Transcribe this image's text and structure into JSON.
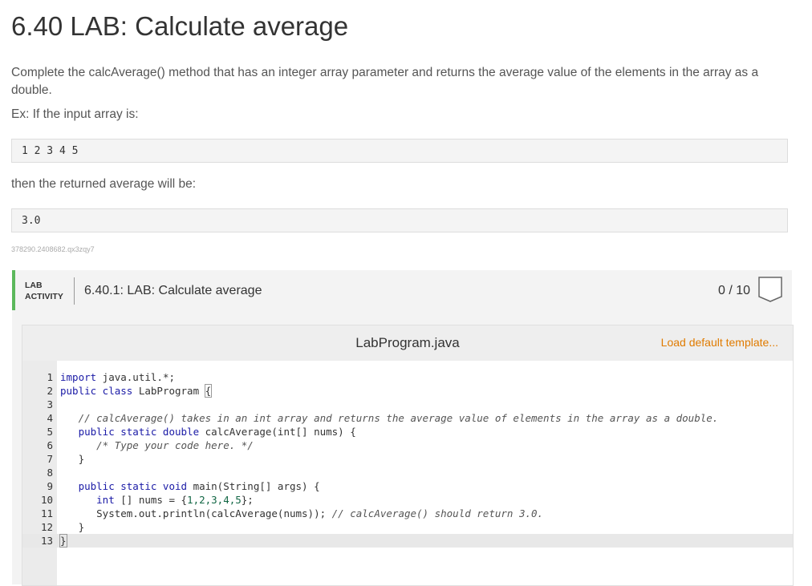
{
  "problem": {
    "title": "6.40 LAB: Calculate average",
    "description": "Complete the calcAverage() method that has an integer array parameter and returns the average value of the elements in the array as a double.",
    "example_intro": "Ex: If the input array is:",
    "example_input": "1 2 3 4 5",
    "then_text": "then the returned average will be:",
    "example_output": "3.0",
    "identifier": "378290.2408682.qx3zqy7"
  },
  "lab_activity": {
    "label_line1": "LAB",
    "label_line2": "ACTIVITY",
    "title": "6.40.1: LAB: Calculate average",
    "score": "0 / 10",
    "accent_color": "#5cb85c"
  },
  "editor": {
    "filename": "LabProgram.java",
    "load_default_label": "Load default template...",
    "lines": [
      {
        "num": "1",
        "parts": [
          {
            "c": "kw",
            "t": "import"
          },
          {
            "c": "",
            "t": " java.util.*;"
          }
        ]
      },
      {
        "num": "2",
        "parts": [
          {
            "c": "kw",
            "t": "public class"
          },
          {
            "c": "",
            "t": " LabProgram "
          },
          {
            "c": "bracket",
            "t": "{"
          }
        ]
      },
      {
        "num": "3",
        "parts": []
      },
      {
        "num": "4",
        "parts": [
          {
            "c": "",
            "t": "   "
          },
          {
            "c": "cm",
            "t": "// calcAverage() takes in an int array and returns the average value of elements in the array as a double."
          }
        ]
      },
      {
        "num": "5",
        "parts": [
          {
            "c": "",
            "t": "   "
          },
          {
            "c": "kw",
            "t": "public static double"
          },
          {
            "c": "",
            "t": " calcAverage(int[] nums) {"
          }
        ]
      },
      {
        "num": "6",
        "parts": [
          {
            "c": "",
            "t": "      "
          },
          {
            "c": "cm",
            "t": "/* Type your code here. */"
          }
        ]
      },
      {
        "num": "7",
        "parts": [
          {
            "c": "",
            "t": "   }"
          }
        ]
      },
      {
        "num": "8",
        "parts": []
      },
      {
        "num": "9",
        "parts": [
          {
            "c": "",
            "t": "   "
          },
          {
            "c": "kw",
            "t": "public static void"
          },
          {
            "c": "",
            "t": " main(String[] args) {"
          }
        ]
      },
      {
        "num": "10",
        "parts": [
          {
            "c": "",
            "t": "      "
          },
          {
            "c": "kw",
            "t": "int"
          },
          {
            "c": "",
            "t": " [] nums = {"
          },
          {
            "c": "num-lit",
            "t": "1,2,3,4,5"
          },
          {
            "c": "",
            "t": "};"
          }
        ]
      },
      {
        "num": "11",
        "parts": [
          {
            "c": "",
            "t": "      System.out.println(calcAverage(nums)); "
          },
          {
            "c": "cm",
            "t": "// calcAverage() should return 3.0."
          }
        ]
      },
      {
        "num": "12",
        "parts": [
          {
            "c": "",
            "t": "   }"
          }
        ]
      },
      {
        "num": "13",
        "parts": [
          {
            "c": "bracket",
            "t": "}"
          }
        ],
        "active": true
      }
    ]
  }
}
